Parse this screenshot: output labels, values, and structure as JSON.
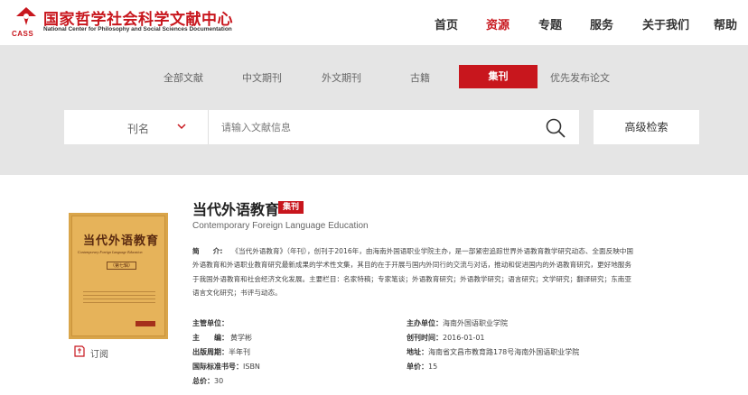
{
  "header": {
    "logo_title": "国家哲学社会科学文献中心",
    "logo_subtitle": "National Center for Philosophy and Social Sciences Documentation",
    "logo_abbr": "CASS",
    "brand_color": "#c8161d",
    "nav": [
      "首页",
      "资源",
      "专题",
      "服务",
      "关于我们",
      "帮助"
    ],
    "nav_active": "资源"
  },
  "tabs": [
    "全部文献",
    "中文期刊",
    "外文期刊",
    "古籍",
    "集刊",
    "优先发布论文"
  ],
  "tab_active": "集刊",
  "search": {
    "field_label": "刊名",
    "placeholder": "请输入文献信息",
    "advanced_label": "高级检索"
  },
  "journal": {
    "title": "当代外语教育",
    "badge": "集刊",
    "title_en": "Contemporary Foreign Language Education",
    "cover": {
      "title": "当代外语教育",
      "title_en": "Contemporary Foreign Language Education",
      "volume": "（第七辑）"
    },
    "subscribe_label": "订阅",
    "intro_label": "简　　介:",
    "intro_text": "《当代外语教育》（年刊），创刊于2016年，由海南外国语职业学院主办，是一部紧密追踪世界外语教育教学研究动态、全面反映中国外语教育和外语职业教育研究最新成果的学术性文集，其目的在于开展与国内外同行的交流与对话，推动和促进国内的外语教育研究，更好地服务于我国外语教育和社会经济文化发展。主要栏目：名家特稿；专家笔谈；外语教育研究；外语教学研究；语言研究；文学研究；翻译研究；东南亚语言文化研究；书评与动态。",
    "fields": {
      "competent_unit_label": "主管单位：",
      "competent_unit": "",
      "sponsor_label": "主办单位：",
      "sponsor": "海南外国语职业学院",
      "editor_label": "主　　编：",
      "editor": "黄学彬",
      "founded_label": "创刊时间：",
      "founded": "2016-01-01",
      "cycle_label": "出版周期：",
      "cycle": "半年刊",
      "address_label": "地址：",
      "address": "海南省文昌市教育路178号海南外国语职业学院",
      "issn_label": "国际标准书号：",
      "issn": "ISBN",
      "unit_price_label": "单价：",
      "unit_price": "15",
      "total_price_label": "总价：",
      "total_price": "30"
    }
  }
}
